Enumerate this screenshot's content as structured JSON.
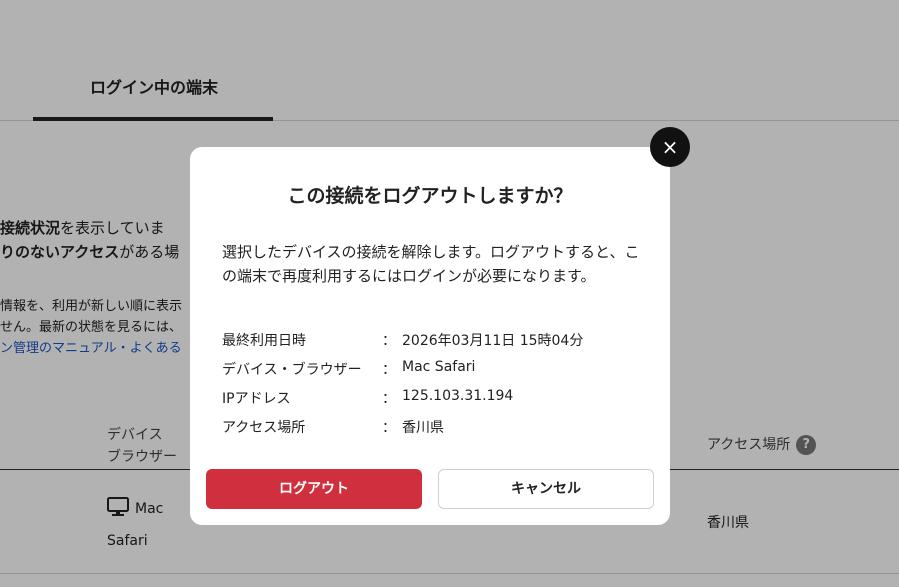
{
  "tabs": {
    "active_label": "ログイン中の端末"
  },
  "intro": {
    "line1_bold": "接続状況",
    "line1_rest": "を表示していま",
    "line2_bold": "りのないアクセス",
    "line2_rest": "がある場",
    "line3": "情報を、利用が新しい順に表示",
    "line4": "せん。最新の状態を見るには、",
    "link": "ン管理のマニュアル・よくある"
  },
  "table": {
    "header_device_line1": "デバイス",
    "header_device_line2": "ブラウザー",
    "header_location": "アクセス場所",
    "help_glyph": "?",
    "row": {
      "device_line1": "Mac",
      "device_line2": "Safari",
      "location": "香川県"
    }
  },
  "modal": {
    "close_glyph": "×",
    "title": "この接続をログアウトしますか？",
    "description": "選択したデバイスの接続を解除します。ログアウトすると、この端末で再度利用するにはログインが必要になります。",
    "colon": "：",
    "info": [
      {
        "label": "最終利用日時",
        "value": "2026年03月11日  15時04分"
      },
      {
        "label": "デバイス・ブラウザー",
        "value": "Mac Safari"
      },
      {
        "label": "IPアドレス",
        "value": "125.103.31.194"
      },
      {
        "label": "アクセス場所",
        "value": "香川県"
      }
    ],
    "logout_label": "ログアウト",
    "cancel_label": "キャンセル"
  },
  "colors": {
    "primary": "#d0303e",
    "link": "#1a56c4",
    "overlay": "rgba(0,0,0,0.3)"
  },
  "icons": {
    "close": "close-icon",
    "help": "help-icon",
    "device": "monitor-icon"
  }
}
